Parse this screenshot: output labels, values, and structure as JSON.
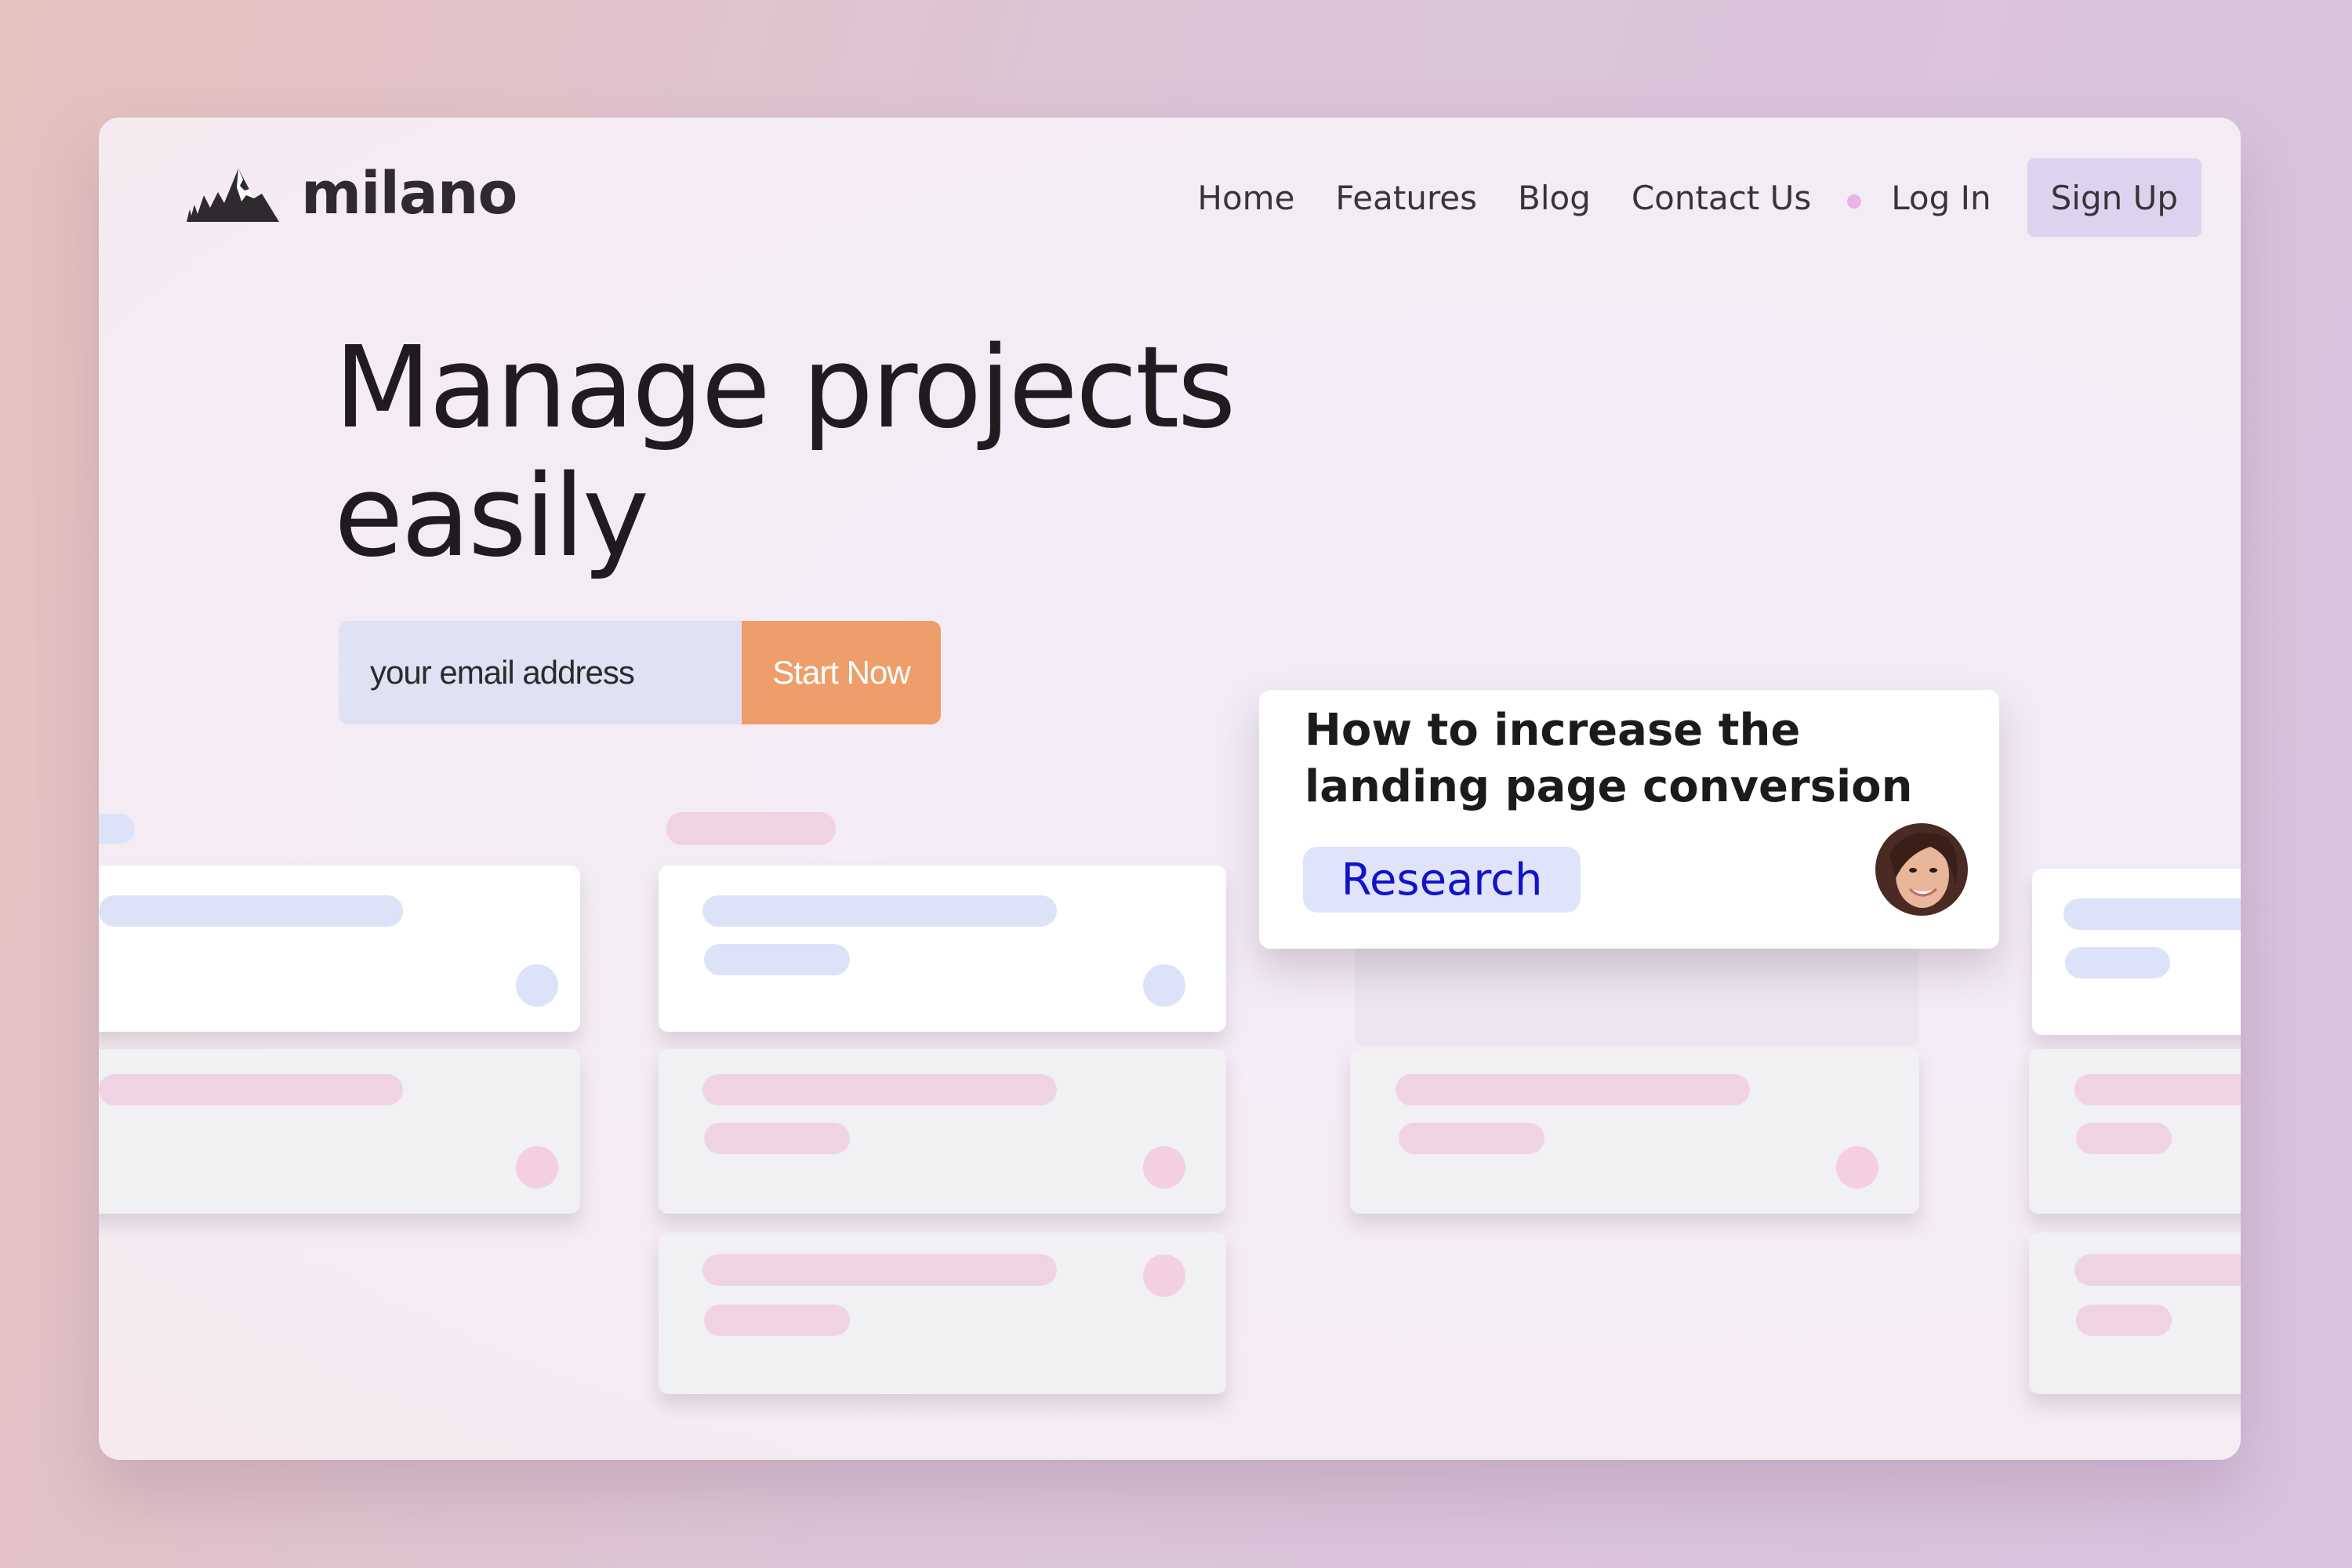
{
  "brand": {
    "name": "milano",
    "logo_icon": "mountain-logo-icon"
  },
  "nav": {
    "items": [
      {
        "label": "Home"
      },
      {
        "label": "Features"
      },
      {
        "label": "Blog"
      },
      {
        "label": "Contact Us"
      }
    ],
    "login_label": "Log In",
    "signup_label": "Sign Up"
  },
  "hero": {
    "headline": "Manage projects easily"
  },
  "cta": {
    "email_placeholder": "your email address",
    "button_label": "Start Now"
  },
  "featured_card": {
    "title": "How to increase the landing page conversion",
    "tag": "Research",
    "avatar_icon": "user-avatar-icon"
  },
  "colors": {
    "accent_orange": "#ee9e6a",
    "tag_text": "#1212c6",
    "signup_bg": "#dcd4ef",
    "input_bg": "#dfe2f3"
  }
}
